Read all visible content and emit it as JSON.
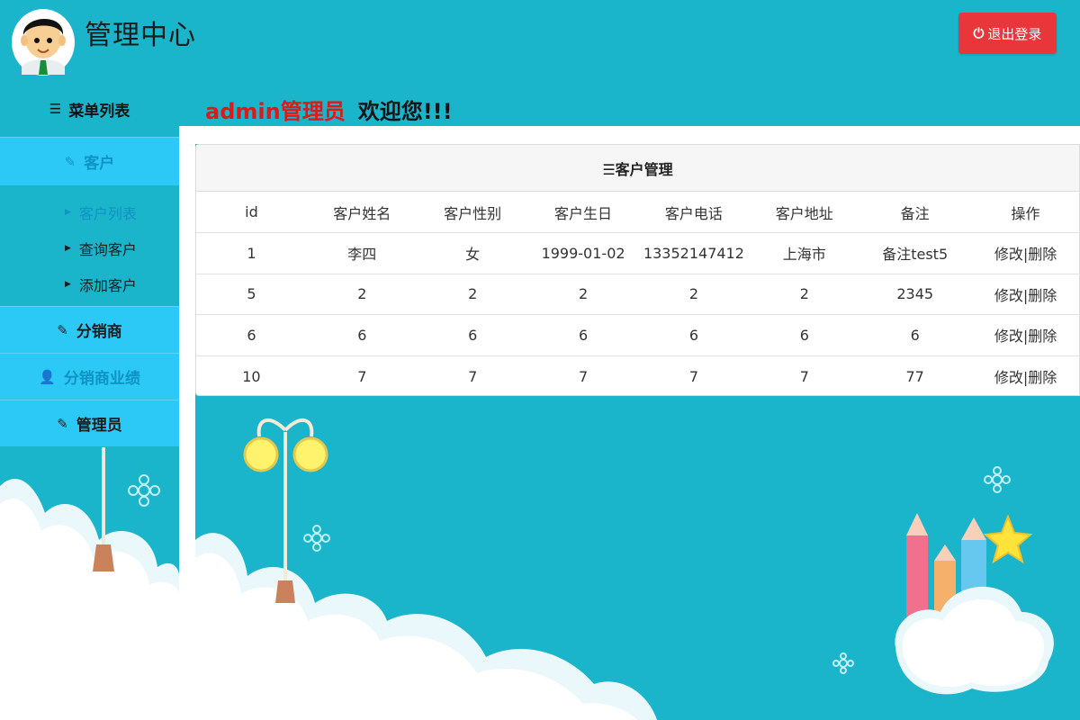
{
  "header": {
    "title": "管理中心",
    "logout_label": "退出登录"
  },
  "sidebar": {
    "menu_title": "菜单列表",
    "groups": [
      {
        "label": "客户",
        "icon": "edit-icon",
        "active": true
      },
      {
        "label": "分销商",
        "icon": "edit-icon"
      },
      {
        "label": "分销商业绩",
        "icon": "user-icon"
      },
      {
        "label": "管理员",
        "icon": "edit-icon"
      }
    ],
    "sub_items": [
      {
        "label": "客户列表",
        "active": true
      },
      {
        "label": "查询客户"
      },
      {
        "label": "添加客户"
      }
    ]
  },
  "welcome": {
    "user": "admin管理员",
    "greeting": "欢迎您!!!"
  },
  "panel": {
    "heading": "☰客户管理",
    "columns": [
      "id",
      "客户姓名",
      "客户性别",
      "客户生日",
      "客户电话",
      "客户地址",
      "备注",
      "操作"
    ],
    "rows": [
      [
        "1",
        "李四",
        "女",
        "1999-01-02",
        "13352147412",
        "上海市",
        "备注test5"
      ],
      [
        "5",
        "2",
        "2",
        "2",
        "2",
        "2",
        "2345"
      ],
      [
        "6",
        "6",
        "6",
        "6",
        "6",
        "6",
        "6"
      ],
      [
        "10",
        "7",
        "7",
        "7",
        "7",
        "7",
        "77"
      ]
    ],
    "edit_label": "修改",
    "separator": "|",
    "delete_label": "删除"
  },
  "colors": {
    "background": "#1ab4cb",
    "nav_group": "#2dc9f6",
    "active_text": "#0e93c4",
    "logout": "#e8363b",
    "admin_text": "#e01818"
  }
}
